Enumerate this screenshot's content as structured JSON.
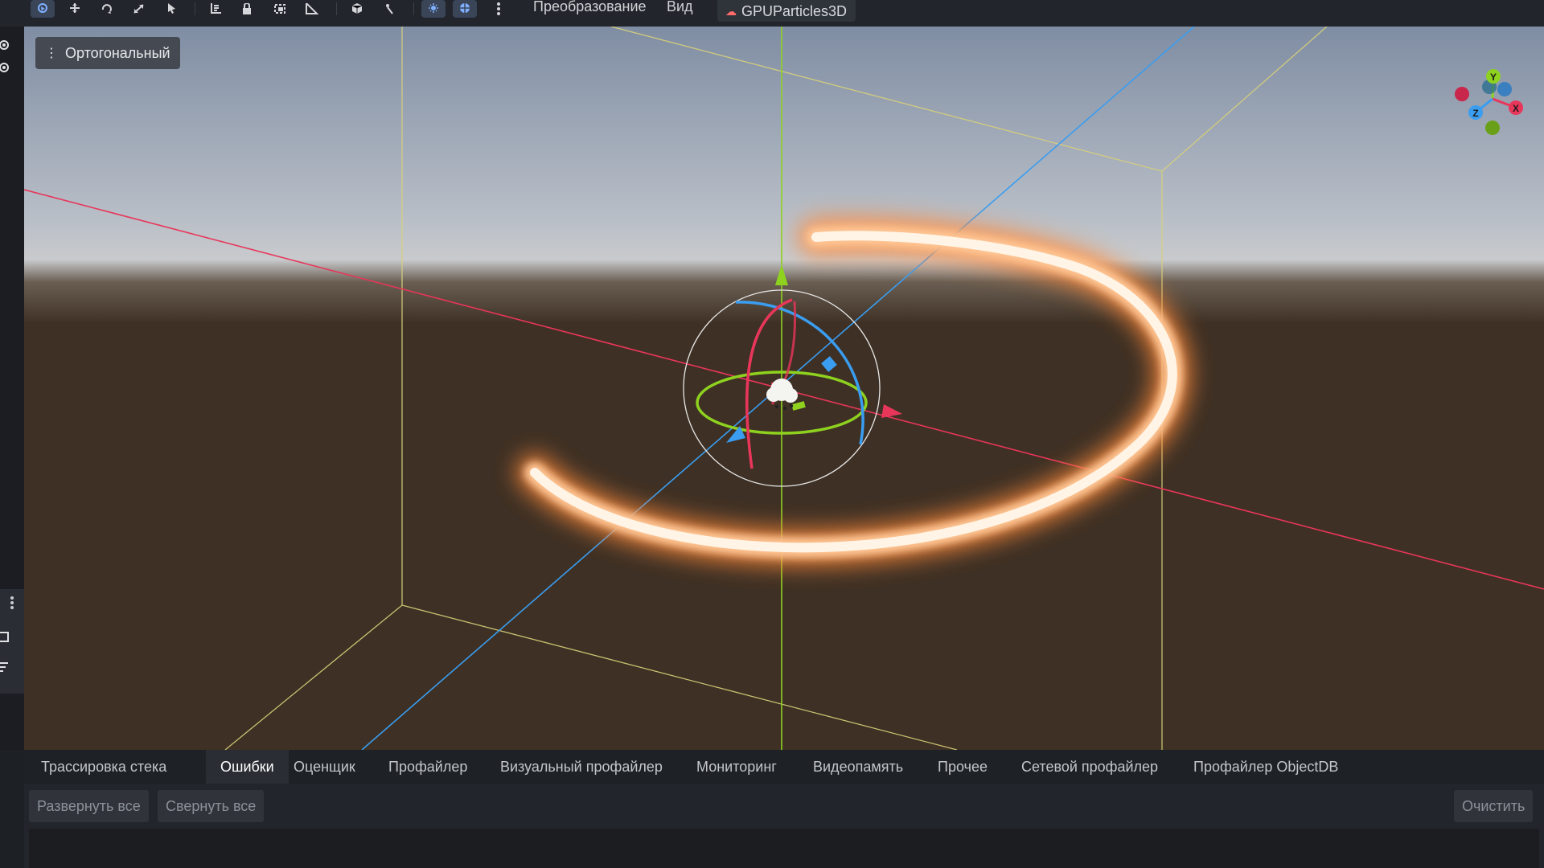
{
  "toolbar": {
    "icons": [
      "select-icon",
      "move-icon",
      "rotate-icon",
      "scale-icon",
      "list-select-icon",
      "ruler-icon",
      "lock-icon",
      "group-icon",
      "snap-icon",
      "cube-icon",
      "bone-icon",
      "sun-icon",
      "environment-icon",
      "more-icon"
    ],
    "menu_transform": "Преобразование",
    "menu_view": "Вид",
    "node_name": "GPUParticles3D"
  },
  "viewport": {
    "view_mode": "Ортогональный",
    "gizmo_labels": {
      "x": "X",
      "y": "Y",
      "z": "Z"
    },
    "colors": {
      "x_axis": "#e8365a",
      "y_axis": "#8ed21f",
      "z_axis": "#3a9df0",
      "bounds": "#d8d07a",
      "particle": "#ffd7b0"
    }
  },
  "bottom_panel": {
    "tabs": [
      "Трассировка стека",
      "Ошибки",
      "Оценщик",
      "Профайлер",
      "Визуальный профайлер",
      "Мониторинг",
      "Видеопамять",
      "Прочее",
      "Сетевой профайлер",
      "Профайлер ObjectDB"
    ],
    "active_tab": "Ошибки",
    "expand_all": "Развернуть все",
    "collapse_all": "Свернуть все",
    "clear": "Очистить"
  }
}
